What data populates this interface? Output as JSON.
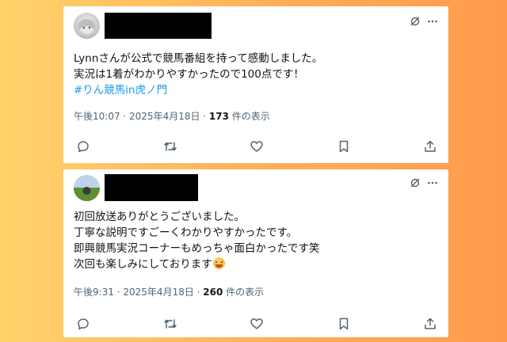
{
  "posts": [
    {
      "lines": [
        "Lynnさんが公式で競馬番組を持って感動しました。",
        "実況は1着がわかりやすかったので100点です！"
      ],
      "hashtag": "#りん競馬in虎ノ門",
      "time": "午後10:07 · 2025年4月18日 · ",
      "views_count": "173",
      "views_label": " 件の表示"
    },
    {
      "lines": [
        "初回放送ありがとうございました。",
        "丁寧な説明ですごーくわかりやすかったです。",
        "即興競馬実況コーナーもめっちゃ面白かったです笑",
        "次回も楽しみにしております"
      ],
      "emoji": "smiling-face-emoji",
      "time": "午後9:31 · 2025年4月18日 · ",
      "views_count": "260",
      "views_label": " 件の表示"
    }
  ],
  "icons": {
    "grok": "grok-icon",
    "more": "more-icon",
    "reply": "reply-icon",
    "repost": "repost-icon",
    "like": "like-icon",
    "bookmark": "bookmark-icon",
    "share": "share-icon"
  },
  "colors": {
    "background_left": "#ffd36b",
    "background_right": "#ff9a4a",
    "text": "#0f1419",
    "muted": "#536471",
    "link": "#1d9bf0"
  }
}
